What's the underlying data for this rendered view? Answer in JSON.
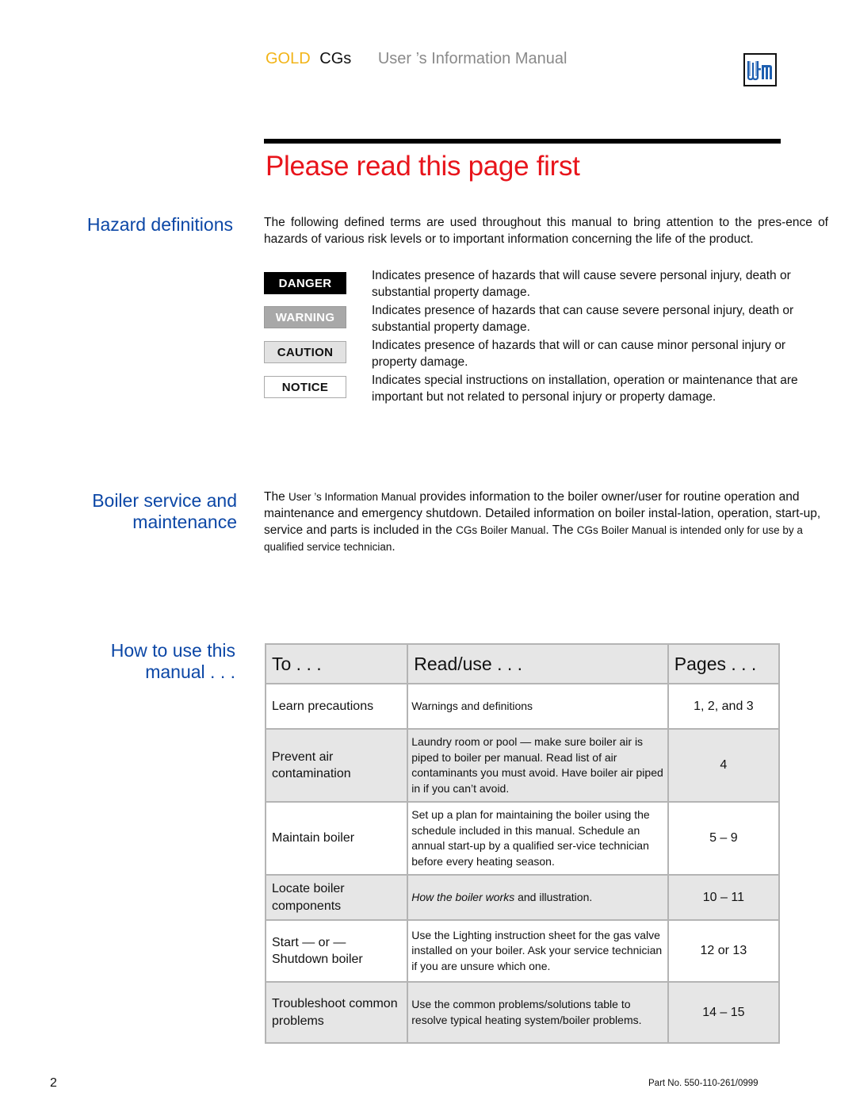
{
  "header": {
    "brand_gold": "GOLD",
    "brand_model": "CGs",
    "manual_title": "User ’s Information Manual",
    "logo_text": "W-M"
  },
  "page_title": "Please read this page first",
  "hazard_section": {
    "heading": "Hazard definitions",
    "intro": "The following defined terms are used throughout this manual to bring attention to the pres-ence of hazards of various risk levels or to important information concerning the life of the product.",
    "definitions": [
      {
        "label": "DANGER",
        "text": "Indicates presence of hazards that will cause severe personal injury, death or substantial property damage."
      },
      {
        "label": "WARNING",
        "text": "Indicates presence of hazards that can cause severe personal injury, death or substantial property damage."
      },
      {
        "label": "CAUTION",
        "text": "Indicates presence of hazards that will or can cause minor personal injury or property damage."
      },
      {
        "label": "NOTICE",
        "text": "Indicates special instructions on installation, operation or maintenance that are important but not related to personal injury or property damage."
      }
    ]
  },
  "boiler_section": {
    "heading_line1": "Boiler service and",
    "heading_line2": "maintenance",
    "text_part1": "The ",
    "text_manual": "User ’s Information Manual",
    "text_part2": " provides information to the boiler owner/user for routine operation and maintenance and emergency shutdown. Detailed information on boiler instal-lation, operation, start-up, service and parts is included in the ",
    "text_boiler_manual": "CGs Boiler Manual",
    "text_part3": ". The ",
    "text_cgs": "CGs",
    "text_part4": " Boiler Manual is intended only for use by a qualified service technician",
    "text_end": "."
  },
  "howto_section": {
    "heading_line1": "How to use this",
    "heading_line2": "manual . . .",
    "columns": [
      "To . . .",
      "Read/use . . .",
      "Pages . . ."
    ],
    "rows": [
      {
        "to": "Learn precautions",
        "read": "Warnings and definitions",
        "pages": "1, 2, and 3"
      },
      {
        "to": "Prevent air contamination",
        "read": "Laundry room or pool — make sure boiler air is piped to boiler per manual. Read list of air contaminants you must avoid. Have boiler air piped in if you can’t avoid.",
        "pages": "4"
      },
      {
        "to": "Maintain boiler",
        "read": "Set up a plan for maintaining the boiler using the schedule included in this manual. Schedule an annual start-up by a qualified ser-vice technician before every heating season.",
        "pages": "5 – 9"
      },
      {
        "to": "Locate boiler components",
        "read_italic": "How the boiler works",
        "read": " and illustration.",
        "pages": "10 – 11"
      },
      {
        "to": "Start — or — Shutdown boiler",
        "read": "Use the Lighting instruction sheet for the gas valve installed on your boiler. Ask your service technician if you are unsure which one.",
        "pages": "12 or 13"
      },
      {
        "to": "Troubleshoot common problems",
        "read": "Use the common problems/solutions table to resolve typical heating system/boiler problems.",
        "pages": "14 – 15"
      }
    ]
  },
  "footer": {
    "page_number": "2",
    "part_number": "Part No. 550-110-261/0999"
  }
}
